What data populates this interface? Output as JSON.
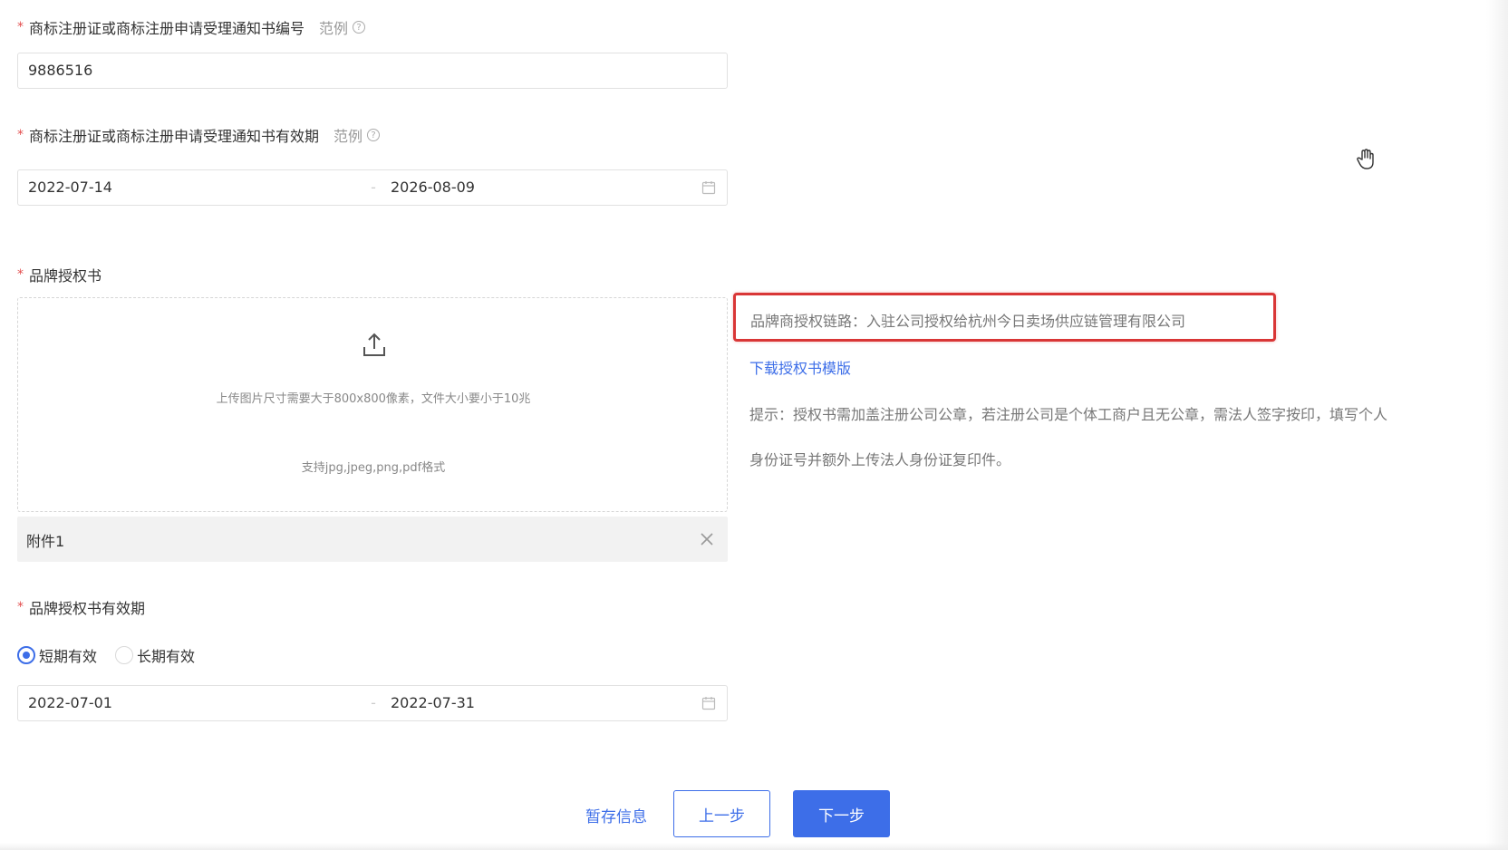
{
  "trademark_number": {
    "label": "商标注册证或商标注册申请受理通知书编号",
    "example_label": "范例",
    "value": "9886516"
  },
  "trademark_validity": {
    "label": "商标注册证或商标注册申请受理通知书有效期",
    "example_label": "范例",
    "start_date": "2022-07-14",
    "end_date": "2026-08-09",
    "separator": "-"
  },
  "brand_authorization": {
    "label": "品牌授权书",
    "upload_hint_size": "上传图片尺寸需要大于800x800像素，文件大小要小于10兆",
    "upload_hint_format": "支持jpg,jpeg,png,pdf格式",
    "attachment_name": "附件1",
    "chain_text": "品牌商授权链路：入驻公司授权给杭州今日卖场供应链管理有限公司",
    "download_link": "下载授权书模版",
    "tip_line1": "提示：授权书需加盖注册公司公章，若注册公司是个体工商户且无公章，需法人签字按印，填写个人",
    "tip_line2": "身份证号并额外上传法人身份证复印件。"
  },
  "authorization_validity": {
    "label": "品牌授权书有效期",
    "options": [
      {
        "label": "短期有效",
        "checked": true
      },
      {
        "label": "长期有效",
        "checked": false
      }
    ],
    "start_date": "2022-07-01",
    "end_date": "2022-07-31",
    "separator": "-"
  },
  "actions": {
    "save_label": "暂存信息",
    "prev_label": "上一步",
    "next_label": "下一步"
  },
  "icons": {
    "help": "question-circle-icon",
    "calendar": "calendar-icon",
    "upload": "upload-icon",
    "close": "close-icon",
    "cursor": "hand-cursor-icon"
  },
  "colors": {
    "primary": "#3d6ee8",
    "required": "#e34d4d",
    "highlight_border": "#d93636"
  }
}
